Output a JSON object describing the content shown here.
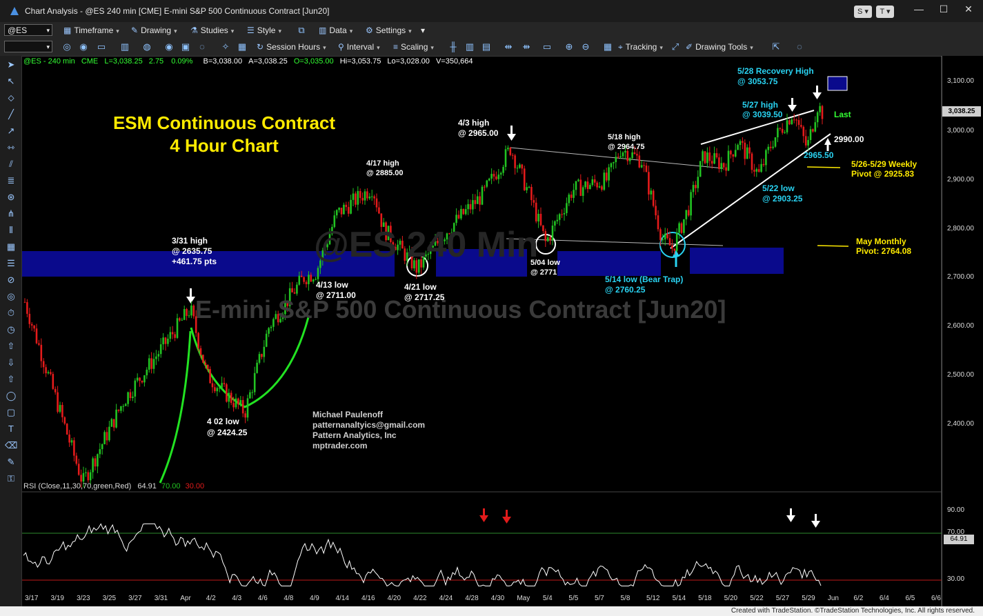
{
  "window": {
    "title": "Chart Analysis - @ES 240 min [CME] E-mini S&P 500 Continuous Contract [Jun20]",
    "controls": [
      "S",
      "T"
    ]
  },
  "toolbar1": {
    "symbol": "@ES",
    "timeframe": "Timeframe",
    "drawing": "Drawing",
    "studies": "Studies",
    "style": "Style",
    "data": "Data",
    "settings": "Settings"
  },
  "toolbar2": {
    "session_hours": "Session Hours",
    "interval": "Interval",
    "scaling": "Scaling",
    "tracking": "Tracking",
    "drawing_tools": "Drawing Tools"
  },
  "header": {
    "symbol": "@ES - 240 min",
    "exchange": "CME",
    "last": "L=3,038.25",
    "change": "2.75",
    "pct": "0.09%",
    "bid": "B=3,038.00",
    "ask": "A=3,038.25",
    "open": "O=3,035.00",
    "high": "Hi=3,053.75",
    "low": "Lo=3,028.00",
    "volume": "V=350,664"
  },
  "chart": {
    "title_line1": "ESM Continuous Contract",
    "title_line2": "4 Hour Chart",
    "watermark": "E-mini S&P 500 Continuous Contract [Jun20]",
    "watermark_bg": "@ES 240 Min",
    "author": "Michael Paulenoff",
    "email": "patternanaltyics@gmail.com",
    "company": "Pattern Analytics, Inc",
    "site": "mptrader.com",
    "last_label": "Last",
    "last_price": "3,038.25"
  },
  "annotations": {
    "a331_1": "3/31 high",
    "a331_2": "@ 2635.75",
    "a331_3": "+461.75 pts",
    "a402_1": "4 02 low",
    "a402_2": "@ 2424.25",
    "a413_1": "4/13 low",
    "a413_2": "@ 2711.00",
    "a417_1": "4/17 high",
    "a417_2": "@ 2885.00",
    "a421_1": "4/21 low",
    "a421_2": "@ 2717.25",
    "a43_1": "4/3 high",
    "a43_2": "@ 2965.00",
    "a504_1": "5/04 low",
    "a504_2": "@ 2771",
    "a518_1": "5/18 high",
    "a518_2": "@ 2964.75",
    "a514_1": "5/14 low (Bear Trap)",
    "a514_2": "@ 2760.25",
    "a528_1": "5/28 Recovery High",
    "a528_2": "@ 3053.75",
    "a527_1": "5/27 high",
    "a527_2": "@ 3039.50",
    "a2990": "2990.00",
    "a2965": "2965.50",
    "a522_1": "5/22 low",
    "a522_2": "@ 2903.25",
    "weekly_1": "5/26-5/29 Weekly",
    "weekly_2": "Pivot @ 2925.83",
    "monthly_1": "May Monthly",
    "monthly_2": "Pivot: 2764.08"
  },
  "rsi": {
    "label": "RSI (Close,11,30,70,green,Red)",
    "value": "64.91",
    "ob": "70.00",
    "os": "30.00",
    "last": "64.91",
    "ticks": [
      "90.00",
      "70.00",
      "30.00"
    ]
  },
  "price_ticks": [
    "3,100.00",
    "3,000.00",
    "2,900.00",
    "2,800.00",
    "2,700.00",
    "2,600.00",
    "2,500.00",
    "2,400.00"
  ],
  "date_ticks": [
    "3/17",
    "3/19",
    "3/23",
    "3/25",
    "3/27",
    "3/31",
    "Apr",
    "4/2",
    "4/3",
    "4/6",
    "4/8",
    "4/9",
    "4/14",
    "4/16",
    "4/20",
    "4/22",
    "4/24",
    "4/28",
    "4/30",
    "May",
    "5/4",
    "5/5",
    "5/7",
    "5/8",
    "5/12",
    "5/14",
    "5/18",
    "5/20",
    "5/22",
    "5/27",
    "5/29",
    "Jun",
    "6/2",
    "6/4",
    "6/5",
    "6/6"
  ],
  "footer": "Created with TradeStation. ©TradeStation Technologies, Inc. All rights reserved.",
  "colors": {
    "up": "#22c322",
    "down": "#e41b1b",
    "zone": "#0a0a8c",
    "cyan": "#29d3f2",
    "yellow": "#ffeb00"
  }
}
